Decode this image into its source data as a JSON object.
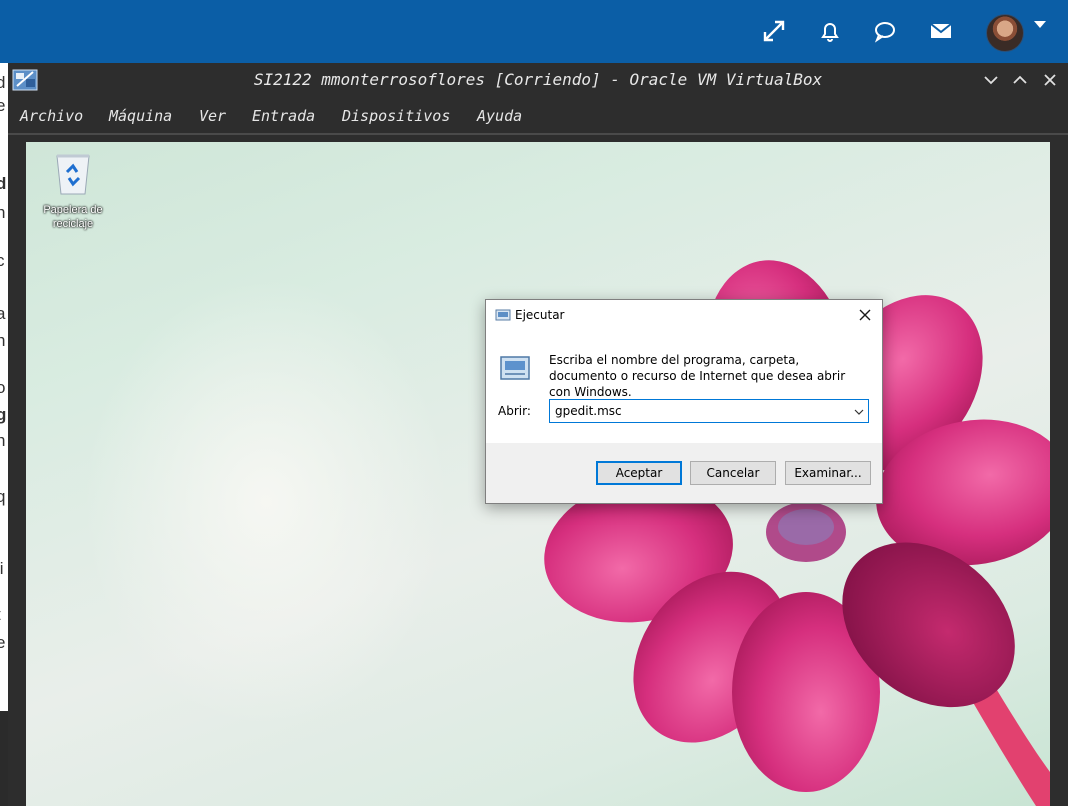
{
  "topbar": {
    "icons": [
      "expand-icon",
      "bell-icon",
      "chat-icon",
      "mail-icon"
    ],
    "brand_color": "#0b5ea6"
  },
  "vbox": {
    "title": "SI2122 mmonterrosoflores [Corriendo] - Oracle VM VirtualBox",
    "menu": [
      "Archivo",
      "Máquina",
      "Ver",
      "Entrada",
      "Dispositivos",
      "Ayuda"
    ]
  },
  "desktop": {
    "recycle_bin_label": "Papelera de reciclaje"
  },
  "run_dialog": {
    "title": "Ejecutar",
    "message": "Escriba el nombre del programa, carpeta, documento o recurso de Internet que desea abrir con Windows.",
    "open_label": "Abrir:",
    "input_value": "gpedit.msc",
    "ok_label": "Aceptar",
    "cancel_label": "Cancelar",
    "browse_label": "Examinar..."
  },
  "background_page_fragments": [
    "d",
    "e",
    "d",
    "n",
    "c",
    "l",
    "a",
    "n",
    "o",
    "g",
    "n",
    "q",
    "li",
    "t",
    "e",
    "r"
  ]
}
